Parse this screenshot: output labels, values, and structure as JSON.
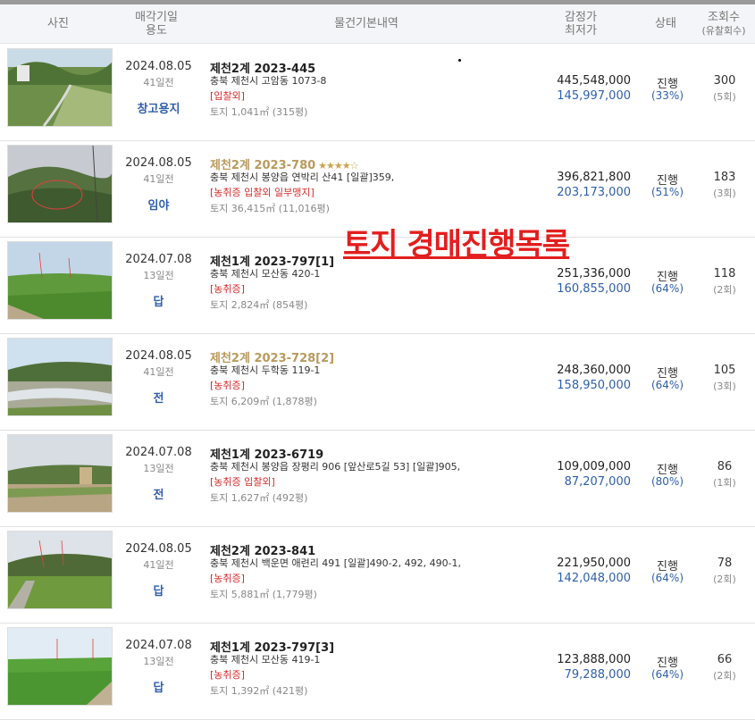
{
  "header": {
    "photo": "사진",
    "date_line1": "매각기일",
    "date_line2": "용도",
    "info": "물건기본내역",
    "price_line1": "감정가",
    "price_line2": "최저가",
    "status": "상태",
    "views_line1": "조회수",
    "views_line2": "(유찰회수)"
  },
  "overlay_title": "토지 경매진행목록",
  "rows": [
    {
      "date": "2024.08.05",
      "days": "41일전",
      "use": "창고용지",
      "case": "제천2계 2023-445",
      "stars": "",
      "addr": "충북 제천시 고암동 1073-8",
      "tags": "[입찰외]",
      "land": "토지 1,041㎡ (315평)",
      "appraisal": "445,548,000",
      "minimum": "145,997,000",
      "status": "진행",
      "pct": "(33%)",
      "views": "300",
      "fails": "(5회)"
    },
    {
      "date": "2024.08.05",
      "days": "41일전",
      "use": "임야",
      "case": "제천2계 2023-780",
      "stars": "★★★★☆",
      "addr": "충북 제천시 봉양읍 연박리 산41  [일괄]359,",
      "tags": "[농취증   입찰외   일부맹지]",
      "land": "토지 36,415㎡ (11,016평)",
      "appraisal": "396,821,800",
      "minimum": "203,173,000",
      "status": "진행",
      "pct": "(51%)",
      "views": "183",
      "fails": "(3회)"
    },
    {
      "date": "2024.07.08",
      "days": "13일전",
      "use": "답",
      "case": "제천1계 2023-797[1]",
      "stars": "",
      "addr": "충북 제천시 모산동 420-1",
      "tags": "[농취증]",
      "land": "토지 2,824㎡ (854평)",
      "appraisal": "251,336,000",
      "minimum": "160,855,000",
      "status": "진행",
      "pct": "(64%)",
      "views": "118",
      "fails": "(2회)"
    },
    {
      "date": "2024.08.05",
      "days": "41일전",
      "use": "전",
      "case": "제천2계 2023-728[2]",
      "stars": "",
      "addr": "충북 제천시 두학동 119-1",
      "tags": "[농취증]",
      "land": "토지 6,209㎡ (1,878평)",
      "appraisal": "248,360,000",
      "minimum": "158,950,000",
      "status": "진행",
      "pct": "(64%)",
      "views": "105",
      "fails": "(3회)"
    },
    {
      "date": "2024.07.08",
      "days": "13일전",
      "use": "전",
      "case": "제천1계 2023-6719",
      "stars": "",
      "addr": "충북 제천시 봉양읍 장평리 906 [앞산로5길 53]  [일괄]905,",
      "tags": "[농취증   입찰외]",
      "land": "토지 1,627㎡ (492평)",
      "appraisal": "109,009,000",
      "minimum": "87,207,000",
      "status": "진행",
      "pct": "(80%)",
      "views": "86",
      "fails": "(1회)"
    },
    {
      "date": "2024.08.05",
      "days": "41일전",
      "use": "답",
      "case": "제천2계 2023-841",
      "stars": "",
      "addr": "충북 제천시 백운면 애련리 491  [일괄]490-2, 492, 490-1,",
      "tags": "[농취증]",
      "land": "토지 5,881㎡ (1,779평)",
      "appraisal": "221,950,000",
      "minimum": "142,048,000",
      "status": "진행",
      "pct": "(64%)",
      "views": "78",
      "fails": "(2회)"
    },
    {
      "date": "2024.07.08",
      "days": "13일전",
      "use": "답",
      "case": "제천1계 2023-797[3]",
      "stars": "",
      "addr": "충북 제천시 모산동 419-1",
      "tags": "[농취증]",
      "land": "토지 1,392㎡ (421평)",
      "appraisal": "123,888,000",
      "minimum": "79,288,000",
      "status": "진행",
      "pct": "(64%)",
      "views": "66",
      "fails": "(2회)"
    }
  ]
}
